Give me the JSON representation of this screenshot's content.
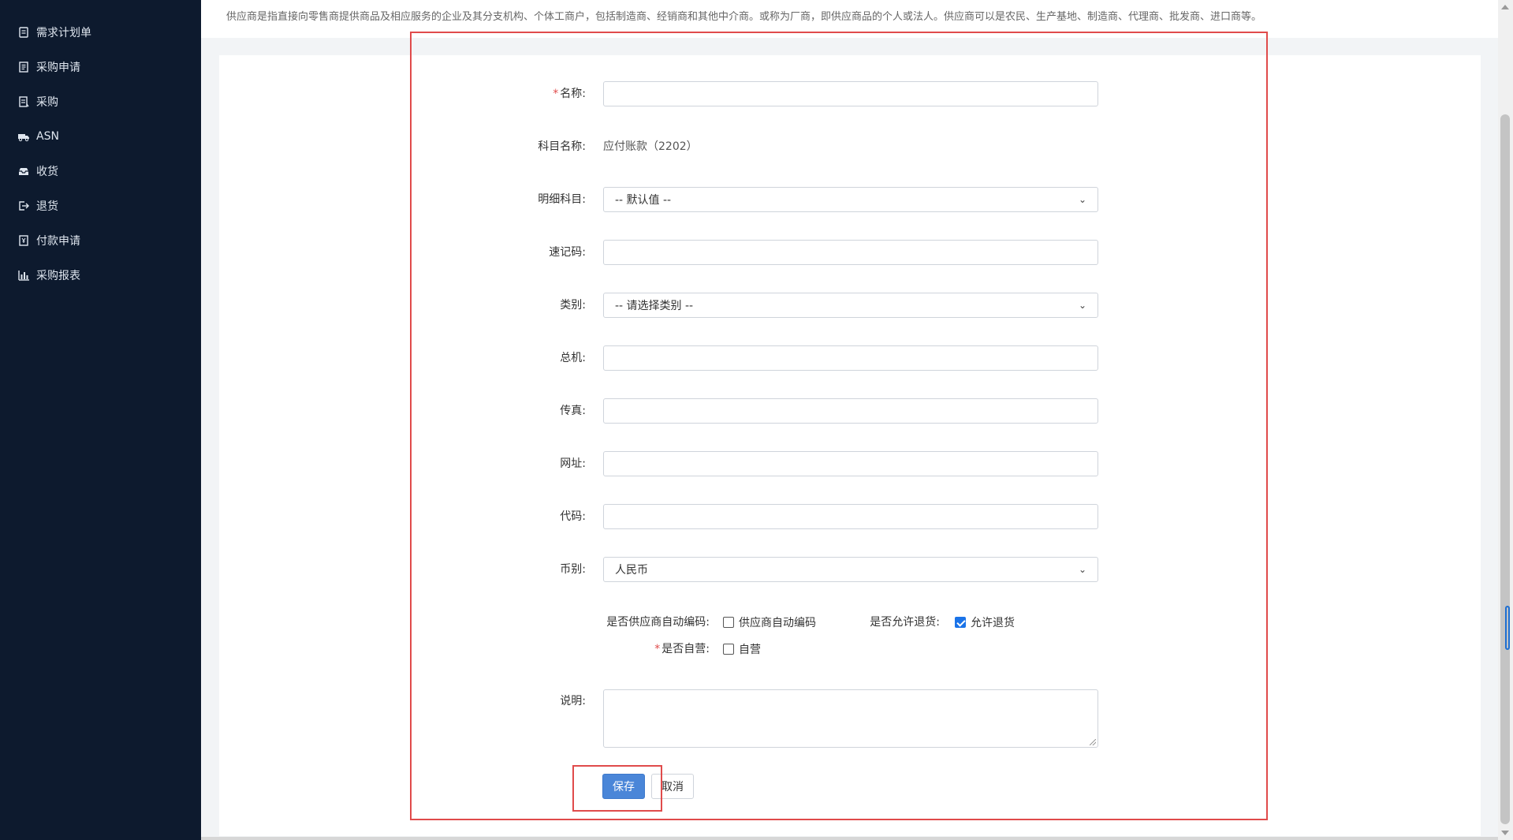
{
  "header": {
    "description": "供应商是指直接向零售商提供商品及相应服务的企业及其分支机构、个体工商户，包括制造商、经销商和其他中介商。或称为厂商，即供应商品的个人或法人。供应商可以是农民、生产基地、制造商、代理商、批发商、进口商等。"
  },
  "sidebar": {
    "items": [
      {
        "label": "需求计划单",
        "icon": "clipboard-icon"
      },
      {
        "label": "采购申请",
        "icon": "document-icon"
      },
      {
        "label": "采购",
        "icon": "list-icon"
      },
      {
        "label": "ASN",
        "icon": "truck-icon"
      },
      {
        "label": "收货",
        "icon": "inbox-icon"
      },
      {
        "label": "退货",
        "icon": "exit-icon"
      },
      {
        "label": "付款申请",
        "icon": "payment-icon"
      },
      {
        "label": "采购报表",
        "icon": "bar-chart-icon"
      }
    ]
  },
  "form": {
    "name_label": "名称:",
    "subject_label": "科目名称:",
    "subject_value": "应付账款（2202）",
    "detail_subject_label": "明细科目:",
    "detail_subject_value": "-- 默认值 --",
    "shortcode_label": "速记码:",
    "category_label": "类别:",
    "category_value": "-- 请选择类别 --",
    "phone_label": "总机:",
    "fax_label": "传真:",
    "website_label": "网址:",
    "code_label": "代码:",
    "currency_label": "币别:",
    "currency_value": "人民币",
    "auto_code_label": "是否供应商自动编码:",
    "auto_code_option": "供应商自动编码",
    "auto_code_checked": false,
    "allow_return_label": "是否允许退货:",
    "allow_return_option": "允许退货",
    "allow_return_checked": true,
    "self_operated_label": "是否自营:",
    "self_operated_option": "自营",
    "self_operated_checked": false,
    "remark_label": "说明:",
    "name_value": "",
    "shortcode_value": "",
    "phone_value": "",
    "fax_value": "",
    "website_value": "",
    "code_value": "",
    "remark_value": ""
  },
  "buttons": {
    "save": "保存",
    "cancel": "取消"
  },
  "colors": {
    "sidebar_bg": "#0d1a2e",
    "primary": "#4a86d8",
    "highlight": "#e04b4b",
    "required": "#e04b4b"
  }
}
